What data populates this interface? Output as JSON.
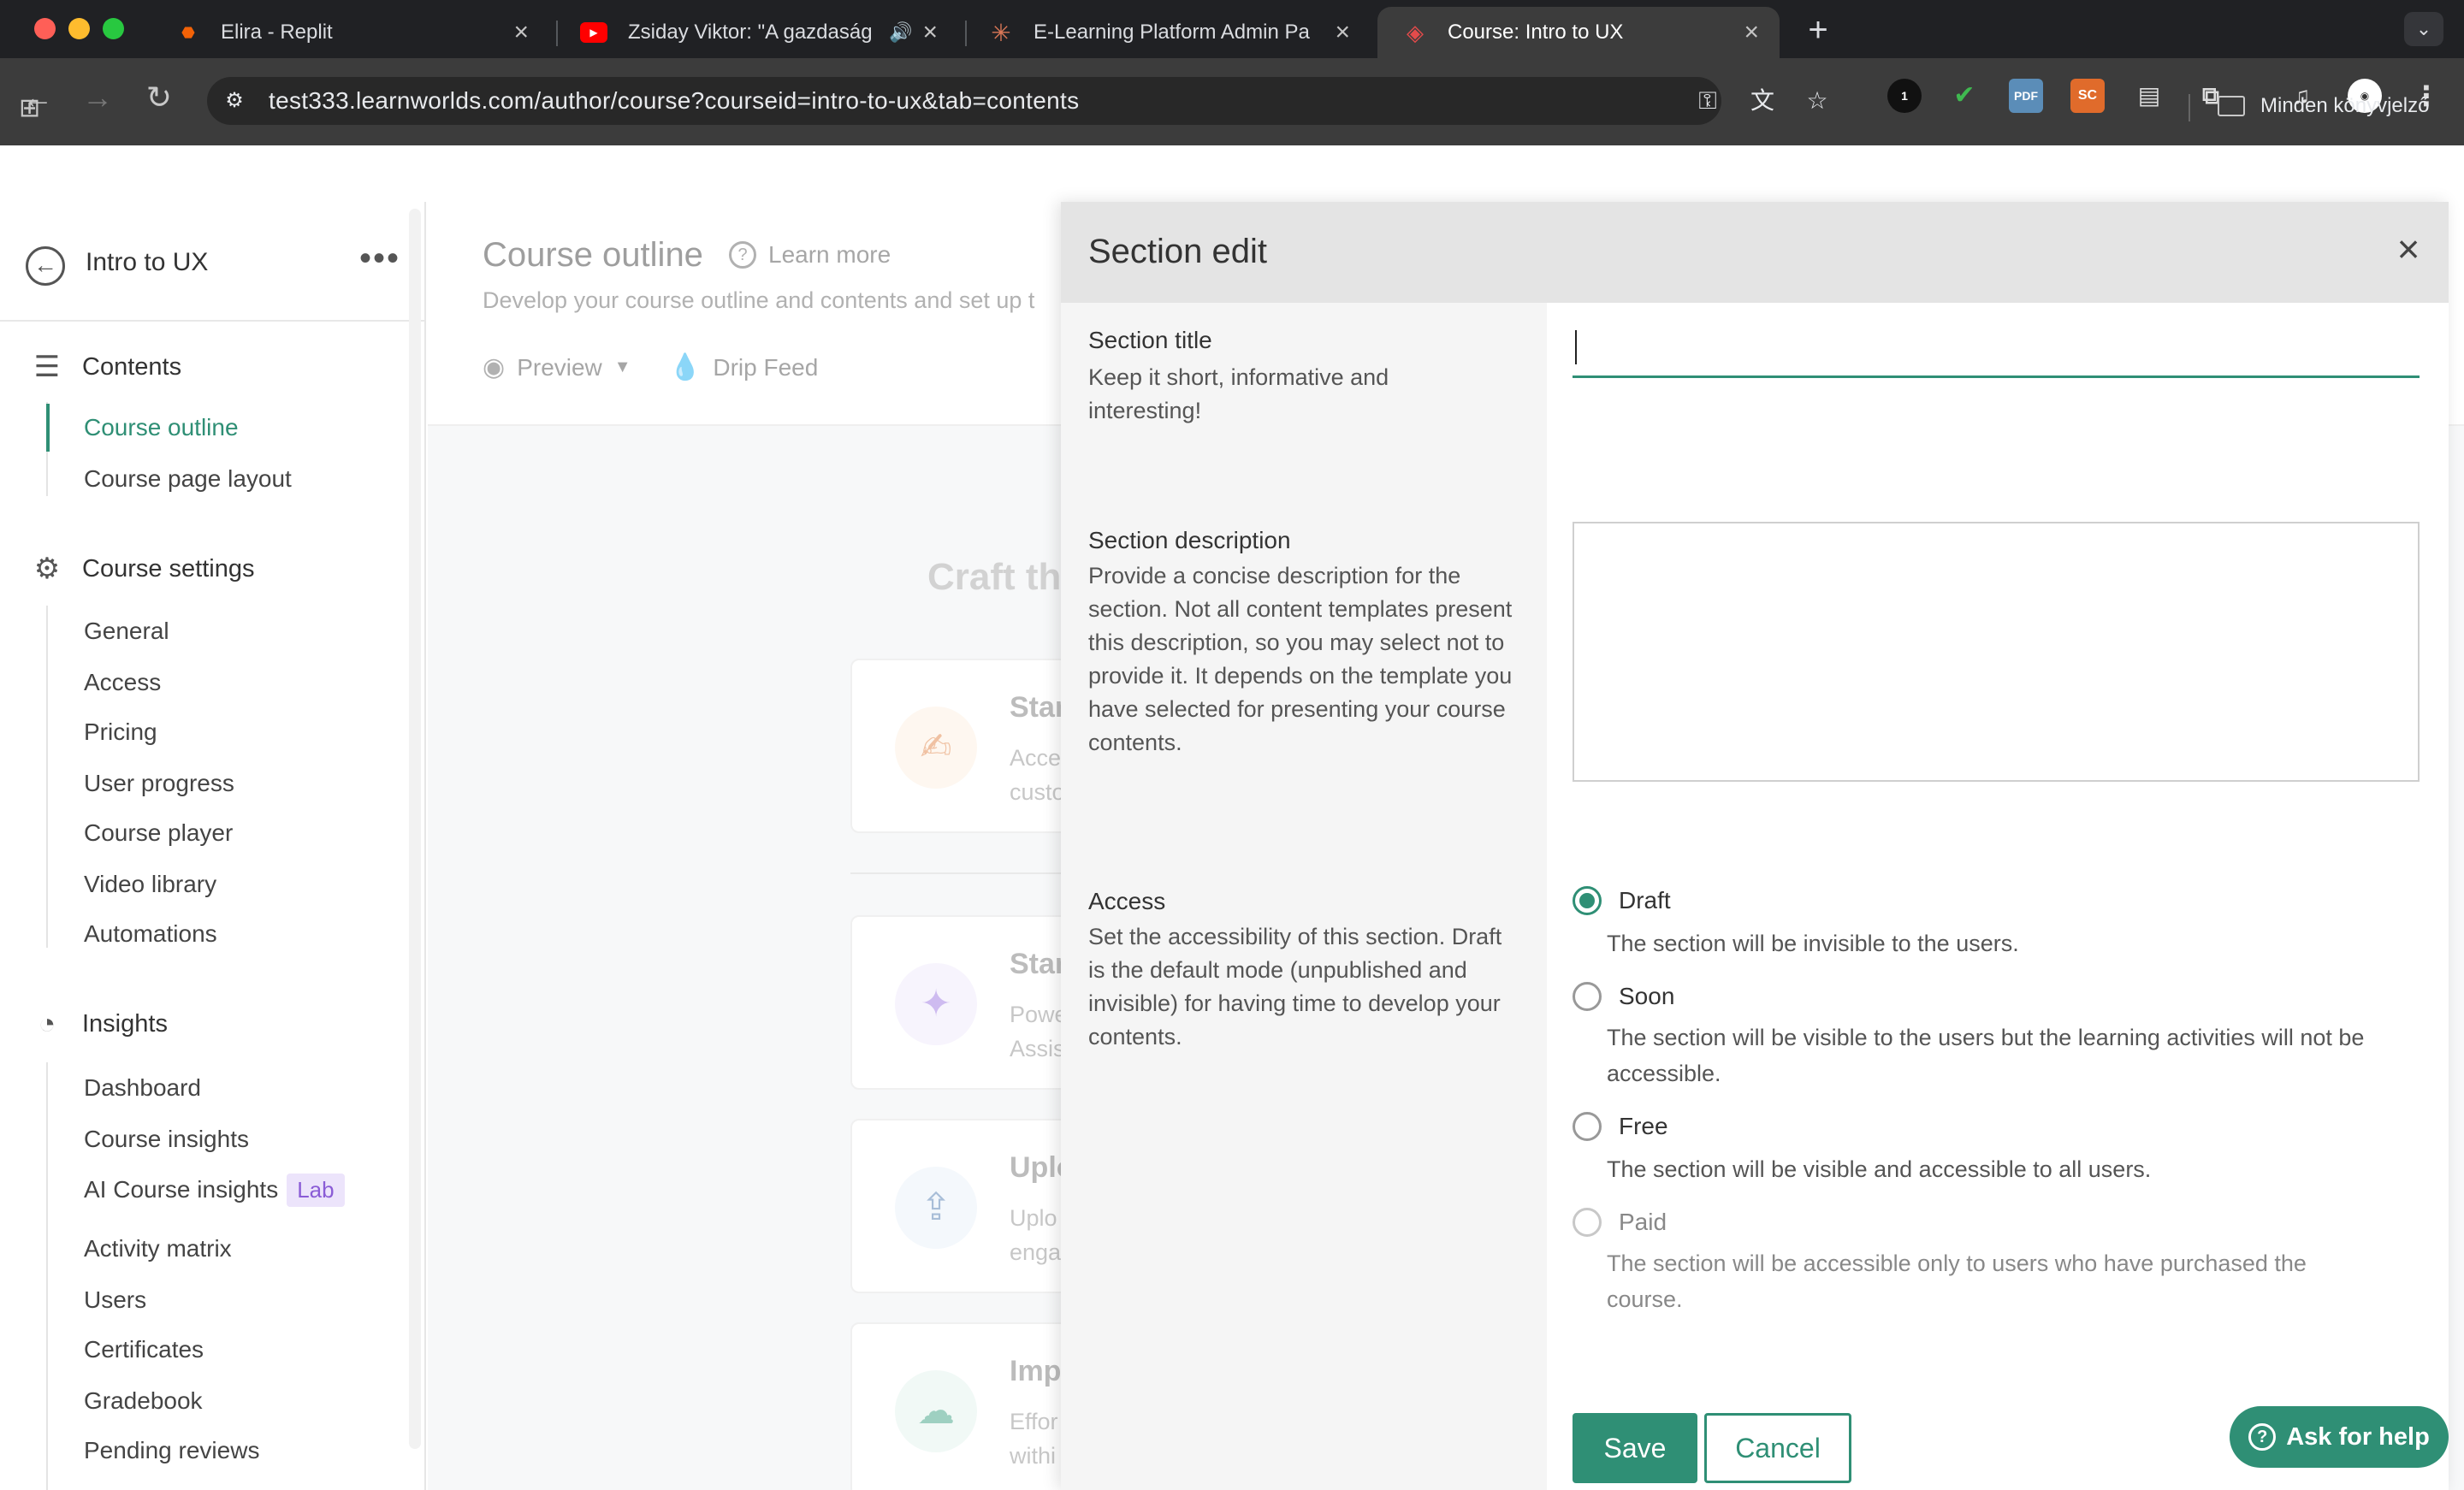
{
  "browser": {
    "tabs": [
      {
        "title": "Elira - Replit",
        "fav_color": "#f26207",
        "fav_glyph": "⬣",
        "active": false
      },
      {
        "title": "Zsiday Viktor: \"A gazdaság",
        "fav_color": "#ff0000",
        "fav_glyph": "▶",
        "active": false,
        "audio": "🔊"
      },
      {
        "title": "E-Learning Platform Admin Pa",
        "fav_color": "#d97757",
        "fav_glyph": "✳",
        "active": false
      },
      {
        "title": "Course: Intro to UX",
        "fav_color": "#ffffff",
        "fav_glyph": "◈",
        "active": true
      }
    ],
    "new_tab": "+",
    "url": "test333.learnworlds.com/author/course?courseid=intro-to-ux&tab=contents",
    "bookmarks_label": "Minden könyvjelző",
    "extensions": [
      {
        "name": "ext-badge",
        "label": "1"
      },
      {
        "name": "pdf-extension",
        "label": "PDF",
        "color": "#5b8db8"
      },
      {
        "name": "sc-extension",
        "label": "SC",
        "color": "#e06b2b"
      }
    ]
  },
  "sidebar": {
    "course_name": "Intro to UX",
    "groups": [
      {
        "label": "Contents",
        "items": [
          "Course outline",
          "Course page layout"
        ],
        "active_item": "Course outline"
      },
      {
        "label": "Course settings",
        "items": [
          "General",
          "Access",
          "Pricing",
          "User progress",
          "Course player",
          "Video library",
          "Automations"
        ]
      },
      {
        "label": "Insights",
        "items": [
          "Dashboard",
          "Course insights",
          "AI Course insights",
          "Activity matrix",
          "Users",
          "Certificates",
          "Gradebook",
          "Pending reviews"
        ]
      }
    ],
    "lab_badge": "Lab"
  },
  "main": {
    "title": "Course outline",
    "learn_more": "Learn more",
    "description": "Develop your course outline and contents and set up t",
    "preview_label": "Preview",
    "drip_feed_label": "Drip Feed",
    "craft_heading": "Craft th",
    "cards": [
      {
        "title": "Star",
        "desc_lines": [
          "Acce",
          "custo"
        ],
        "icon": "✍"
      },
      {
        "title": "Star",
        "desc_lines": [
          "Powe",
          "Assis"
        ],
        "icon": "✦"
      },
      {
        "title": "Uplo",
        "desc_lines": [
          "Uplo",
          "enga"
        ],
        "icon": "⇪"
      },
      {
        "title": "Imp",
        "desc_lines": [
          "Effor",
          "withi"
        ],
        "icon": "☁"
      }
    ]
  },
  "panel": {
    "title": "Section edit",
    "section_title": {
      "label": "Section title",
      "help": "Keep it short, informative and interesting!",
      "value": ""
    },
    "section_description": {
      "label": "Section description",
      "help": "Provide a concise description for the section. Not all content templates present this description, so you may select not to provide it. It depends on the template you have selected for presenting your course contents.",
      "value": ""
    },
    "access": {
      "label": "Access",
      "help": "Set the accessibility of this section. Draft is the default mode (unpublished and invisible) for having time to develop your contents.",
      "options": [
        {
          "label": "Draft",
          "help": "The section will be invisible to the users.",
          "checked": true,
          "disabled": false
        },
        {
          "label": "Soon",
          "help": "The section will be visible to the users but the learning activities will not be accessible.",
          "checked": false,
          "disabled": false
        },
        {
          "label": "Free",
          "help": "The section will be visible and accessible to all users.",
          "checked": false,
          "disabled": false
        },
        {
          "label": "Paid",
          "help": "The section will be accessible only to users who have purchased the course.",
          "checked": false,
          "disabled": true
        }
      ]
    },
    "save_label": "Save",
    "cancel_label": "Cancel"
  },
  "help_button": "Ask for help",
  "colors": {
    "accent": "#2f8f75",
    "lab_bg": "#ece4fb",
    "lab_fg": "#8a5cd6"
  }
}
